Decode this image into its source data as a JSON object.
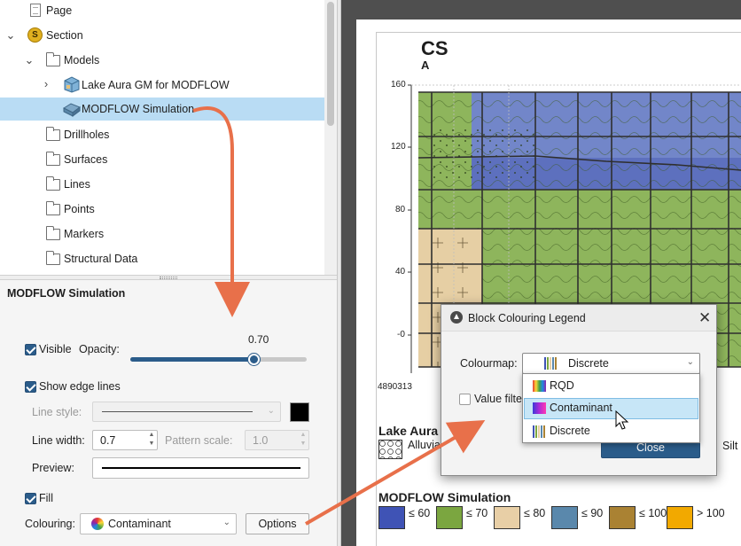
{
  "tree": {
    "items": [
      {
        "label": "Page",
        "icon": "page-icon",
        "indent": 0,
        "expanded": null,
        "selected": false
      },
      {
        "label": "Section",
        "icon": "section-icon",
        "indent": 0,
        "expanded": true,
        "selected": false
      },
      {
        "label": "Models",
        "icon": "folder-icon",
        "indent": 1,
        "expanded": true,
        "selected": false
      },
      {
        "label": "Lake Aura GM for MODFLOW",
        "icon": "geological-model-icon",
        "indent": 2,
        "expanded": false,
        "selected": false
      },
      {
        "label": "MODFLOW Simulation",
        "icon": "modflow-model-icon",
        "indent": 2,
        "expanded": null,
        "selected": true
      },
      {
        "label": "Drillholes",
        "icon": "folder-icon",
        "indent": 1,
        "expanded": null,
        "selected": false
      },
      {
        "label": "Surfaces",
        "icon": "folder-icon",
        "indent": 1,
        "expanded": null,
        "selected": false
      },
      {
        "label": "Lines",
        "icon": "folder-icon",
        "indent": 1,
        "expanded": null,
        "selected": false
      },
      {
        "label": "Points",
        "icon": "folder-icon",
        "indent": 1,
        "expanded": null,
        "selected": false
      },
      {
        "label": "Markers",
        "icon": "folder-icon",
        "indent": 1,
        "expanded": null,
        "selected": false
      },
      {
        "label": "Structural Data",
        "icon": "folder-icon",
        "indent": 1,
        "expanded": null,
        "selected": false
      }
    ]
  },
  "properties": {
    "title": "MODFLOW Simulation",
    "visible_label": "Visible",
    "visible_checked": true,
    "opacity_label": "Opacity:",
    "opacity_value": "0.70",
    "opacity_fraction": 0.7,
    "show_edge_lines_label": "Show edge lines",
    "show_edge_lines_checked": true,
    "line_style_label": "Line style:",
    "line_width_label": "Line width:",
    "line_width_value": "0.7",
    "pattern_scale_label": "Pattern scale:",
    "pattern_scale_value": "1.0",
    "preview_label": "Preview:",
    "fill_label": "Fill",
    "fill_checked": true,
    "colouring_label": "Colouring:",
    "colouring_value": "Contaminant",
    "options_button": "Options",
    "edge_colour": "#000000"
  },
  "section": {
    "title": "CS",
    "subtitle": "A",
    "y_ticks": [
      "160",
      "120",
      "80",
      "40",
      "-0"
    ],
    "x_tick": "4890313"
  },
  "legend": {
    "geology_title": "Lake Aura",
    "geology_item": "Alluvial",
    "geology_item_right": "Silt",
    "modflow_title": "MODFLOW Simulation",
    "bins": [
      {
        "label": "≤ 60",
        "color": "#3f53b5"
      },
      {
        "label": "≤ 70",
        "color": "#7ba640"
      },
      {
        "label": "≤ 80",
        "color": "#e8cfa6"
      },
      {
        "label": "≤ 90",
        "color": "#5a88ac"
      },
      {
        "label": "≤ 100",
        "color": "#aa8233"
      },
      {
        "label": "> 100",
        "color": "#f2a900"
      }
    ]
  },
  "dialog": {
    "title": "Block Colouring Legend",
    "colourmap_label": "Colourmap:",
    "colourmap_value": "Discrete",
    "value_filter_label": "Value filter",
    "close_button": "Close",
    "options": [
      {
        "label": "RQD",
        "highlighted": false
      },
      {
        "label": "Contaminant",
        "highlighted": true
      },
      {
        "label": "Discrete",
        "highlighted": false
      }
    ]
  },
  "colors": {
    "accent": "#2b5c8a",
    "selection": "#b9dcf4",
    "annotation_arrow": "#e8704a"
  }
}
